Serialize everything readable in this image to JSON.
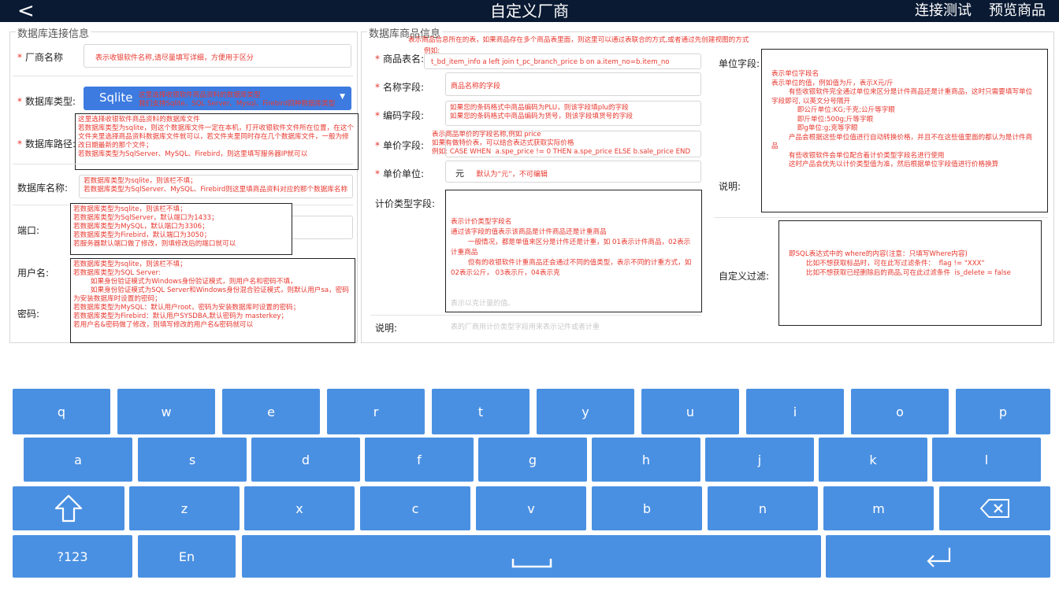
{
  "header": {
    "back": "<",
    "title": "自定义厂商",
    "test_connection": "连接测试",
    "preview_goods": "预览商品"
  },
  "left_panel": {
    "title": "数据库连接信息",
    "vendor_name": {
      "label": "厂商名称",
      "hint": "表示收银软件名称,请尽量填写详细，方便用于区分"
    },
    "db_type": {
      "label": "数据库类型:",
      "selected": "Sqlite",
      "note": "这里选择收银软件商品资料的数据库类型\n我们支持Sqlite、SQL Server、Mysql、Firebird四种数据库类型"
    },
    "db_path": {
      "label": "数据库路径:",
      "note": "这里选择收银软件商品资料的数据库文件\n若数据库类型为sqlite，则这个数据库文件一定在本机，打开收银软件文件所在位置，在这个文件夹里选择商品资料数据库文件就可以，若文件夹里同时存在几个数据库文件，一般为修改日期最新的那个文件；\n若数据库类型为SqlServer、MySQL、Firebird，则这里填写服务器IP就可以"
    },
    "db_name": {
      "label": "数据库名称:",
      "note": "若数据库类型为sqlite，则该栏不填；\n若数据库类型为SqlServer、MySQL、Firebird则这里填商品资料对应的那个数据库名称"
    },
    "port": {
      "label": "端口:",
      "note": "若数据库类型为sqlite，则该栏不填；\n若数据库类型为SqlServer，默认端口为1433；\n若数据库类型为MySQL，默认端口为3306；\n若数据库类型为Firebird，默认端口为3050；\n若服务器默认端口做了修改，则填修改后的端口就可以"
    },
    "username": {
      "label": "用户名:",
      "note": "若数据库类型为sqlite，则该栏不填；\n若数据库类型为SQL Server:\n        如果身份验证模式为Windows身份验证模式，则用户名和密码不填，\n        如果身份验证模式为SQL Server和Windows身份混合验证模式，则默认用户sa，密码为安装数据库时设置的密码；\n若数据库类型为MySQL：默认用户root，密码为安装数据库时设置的密码；\n若数据库类型为Firebird：默认用户SYSDBA,默认密码为 masterkey；\n若用户名&密码做了修改，则填写修改的用户名&密码就可以"
    },
    "password": {
      "label": "密码:"
    }
  },
  "right_panel": {
    "title": "数据库商品信息",
    "top_note": "表示商品信息所在的表，如果商品存在多个商品表里面，则这里可以通过表联合的方式,或者通过先创建视图的方式",
    "table_name": {
      "label": "商品表名:",
      "example_label": "例如:",
      "value": "t_bd_item_info a left join t_pc_branch_price b on a.item_no=b.item_no"
    },
    "name_field": {
      "label": "名称字段:",
      "hint": "商品名称的字段"
    },
    "code_field": {
      "label": "编码字段:",
      "hint": "如果您的条码格式中商品编码为PLU，则该字段填plu的字段\n如果您的条码格式中商品编码为货号，则该字段填货号的字段"
    },
    "price_field": {
      "label": "单价字段:",
      "hint": "表示商品单价的字段名称,例如 price\n如果有做特价表，可以结合表达式获取实际价格\n例如: CASE WHEN  a.spe_price != 0 THEN a.spe_price ELSE b.sale_price END"
    },
    "price_unit": {
      "label": "单价单位:",
      "value": "元",
      "hint": "默认为“元”，不可编辑"
    },
    "pricing_type_field": {
      "label": "计价类型字段:",
      "note": "表示计价类型字段名\n通过该字段的值表示该商品是计件商品还是计重商品\n        一般情况，都是单值来区分是计件还是计重，如 01表示计件商品，02表示计重商品\n        但有的收银软件计重商品还会通过不同的值类型，表示不同的计重方式，如 02表示公斤， 03表示斤，04表示克",
      "ghost": "表示以克计量的值。"
    },
    "description_left": {
      "label": "说明:",
      "ghost": "表的厂商用计价类型字段用来表示记件或者计重"
    },
    "unit_field": {
      "label": "单位字段:",
      "note": "表示单位字段名\n表示单位的值，例如值为斤，表示X元/斤\n        有些收银软件完全通过单位来区分是计件商品还是计重商品，这时只需要填写单位字段即可, 以英文分号隔开\n            即公斤单位:KG;千克;公斤等字眼\n            即斤单位:500g;斤等字眼\n            即g单位:g;克等字眼\n        产品会根据这些单位值进行自动转换价格，并且不在这些值里面的都认为是计件商品\n        有些收银软件会单位配合着计价类型字段名进行使用\n        这时产品会优先以计价类型值为准，然后根据单位字段值进行价格换算"
    },
    "description_right": {
      "label": "说明:"
    },
    "custom_filter": {
      "label": "自定义过滤:",
      "note": "即SQL表达式中的 where的内容(注意：只填写Where内容)\n        比如不想获取标品时，可在此写过滤条件：  flag != \"XXX\"\n        比如不想获取已经删除后的商品,可在此过滤条件  is_delete = false"
    }
  },
  "keyboard": {
    "row1": [
      "q",
      "w",
      "e",
      "r",
      "t",
      "y",
      "u",
      "i",
      "o",
      "p"
    ],
    "row2": [
      "a",
      "s",
      "d",
      "f",
      "g",
      "h",
      "j",
      "k",
      "l"
    ],
    "row3": [
      "z",
      "x",
      "c",
      "v",
      "b",
      "n",
      "m"
    ],
    "numbers_key": "?123",
    "lang_key": "En",
    "colors": {
      "key": "#4a90e2",
      "header": "#0a1a33",
      "note_text": "#e8382f",
      "dropdown": "#3d7be0"
    }
  }
}
